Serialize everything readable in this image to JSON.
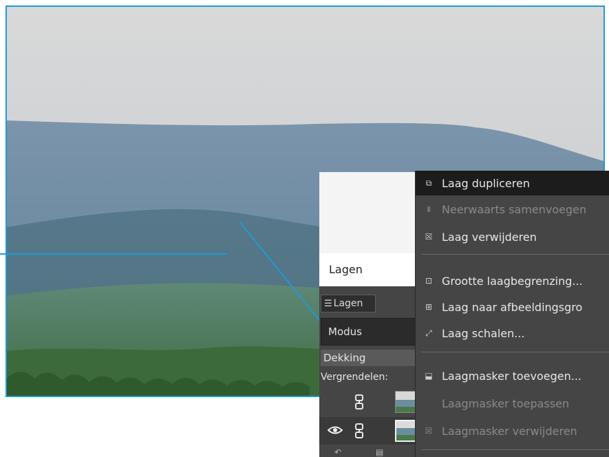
{
  "panel": {
    "title": "Lagen",
    "tab_label": "Lagen",
    "mode_label": "Modus",
    "opacity_label": "Dekking",
    "lock_label": "Vergrendelen:"
  },
  "menu": {
    "items": [
      {
        "label": "Laag dupliceren",
        "icon": "duplicate-layer-icon",
        "state": "active"
      },
      {
        "label": "Neerwaarts samenvoegen",
        "icon": "merge-down-icon",
        "state": "disabled"
      },
      {
        "label": "Laag verwijderen",
        "icon": "delete-layer-icon",
        "state": "enabled"
      },
      {
        "label": "Grootte laagbegrenzing...",
        "icon": "layer-boundary-size-icon",
        "state": "enabled"
      },
      {
        "label": "Laag naar afbeeldingsgro",
        "icon": "layer-to-image-size-icon",
        "state": "enabled"
      },
      {
        "label": "Laag schalen...",
        "icon": "scale-layer-icon",
        "state": "enabled"
      },
      {
        "label": "Laagmasker toevoegen...",
        "icon": "add-layer-mask-icon",
        "state": "enabled"
      },
      {
        "label": "Laagmasker toepassen",
        "icon": "",
        "state": "disabled"
      },
      {
        "label": "Laagmasker verwijderen",
        "icon": "delete-layer-mask-icon",
        "state": "disabled"
      }
    ]
  },
  "colors": {
    "accent": "#1d9bd6",
    "panel_bg": "#454545",
    "menu_active": "#1c1c1c"
  }
}
